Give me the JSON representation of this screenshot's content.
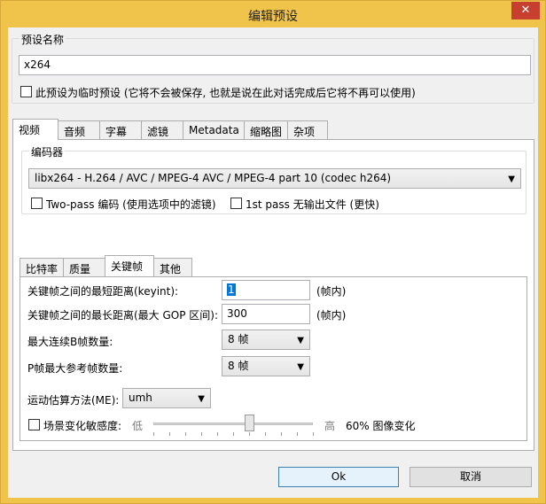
{
  "window": {
    "title": "编辑预设",
    "close_label": "✕"
  },
  "preset": {
    "group_label": "预设名称",
    "name_value": "x264",
    "temp_checkbox_label": "此预设为临时预设 (它将不会被保存, 也就是说在此对话完成后它将不再可以使用)"
  },
  "main_tabs": [
    "视频",
    "音频",
    "字幕",
    "滤镜",
    "Metadata",
    "缩略图",
    "杂项"
  ],
  "encoder": {
    "group_label": "编码器",
    "codec_value": "libx264 - H.264 / AVC / MPEG-4 AVC / MPEG-4 part 10 (codec h264)",
    "twopass_label": "Two-pass 编码 (使用选项中的滤镜)",
    "firstpass_label": "1st pass 无输出文件 (更快)"
  },
  "sub_tabs": [
    "比特率",
    "质量",
    "关键帧",
    "其他"
  ],
  "keyframes": {
    "min_label": "关键帧之间的最短距离(keyint):",
    "min_value": "1",
    "min_unit": "(帧内)",
    "max_label": "关键帧之间的最长距离(最大 GOP 区间):",
    "max_value": "300",
    "max_unit": "(帧内)",
    "bframes_label": "最大连续B帧数量:",
    "bframes_value": "8 帧",
    "refs_label": "P帧最大参考帧数量:",
    "refs_value": "8 帧",
    "me_label": "运动估算方法(ME):",
    "me_value": "umh",
    "scene_label": "场景变化敏感度:",
    "low_label": "低",
    "high_label": "高",
    "scene_value": "60% 图像变化",
    "scene_level": 0.6
  },
  "buttons": {
    "ok": "Ok",
    "cancel": "取消"
  }
}
